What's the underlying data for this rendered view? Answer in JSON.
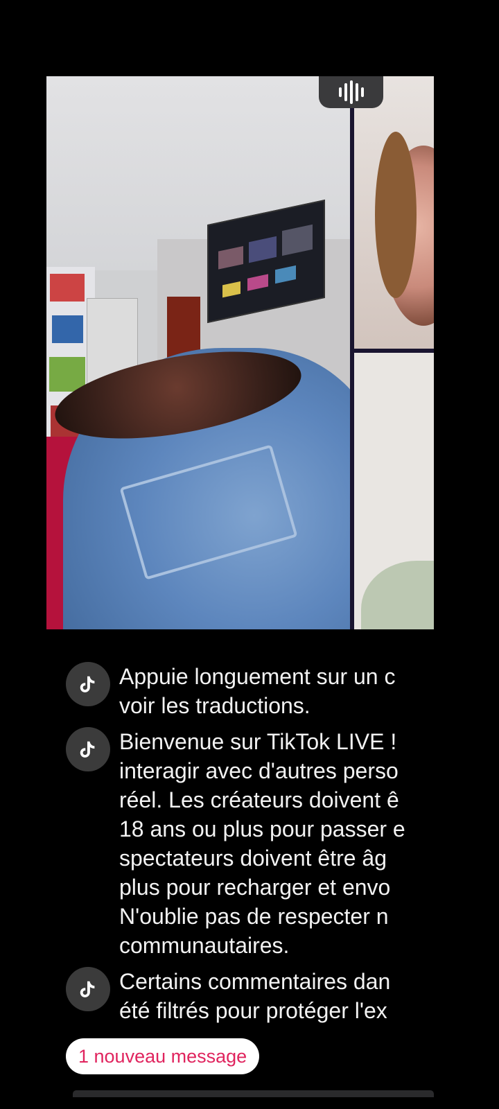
{
  "chat": {
    "messages": [
      {
        "text": "Appuie longuement sur un c\nvoir les traductions."
      },
      {
        "text": "Bienvenue sur TikTok LIVE !\ninteragir avec d'autres perso\nréel. Les créateurs doivent ê\n18 ans ou plus pour passer e\nspectateurs doivent être âg\nplus pour recharger et envo\nN'oublie pas de respecter n\ncommunautaires."
      },
      {
        "text": "Certains commentaires dan\nété filtrés pour protéger l'ex"
      }
    ]
  },
  "new_message_label": "1 nouveau message",
  "colors": {
    "accent": "#e0245e",
    "background": "#000000",
    "avatar_bg": "#3b3b3b"
  },
  "icons": {
    "avatar": "tiktok-logo-icon",
    "audio": "audio-wave-icon"
  }
}
